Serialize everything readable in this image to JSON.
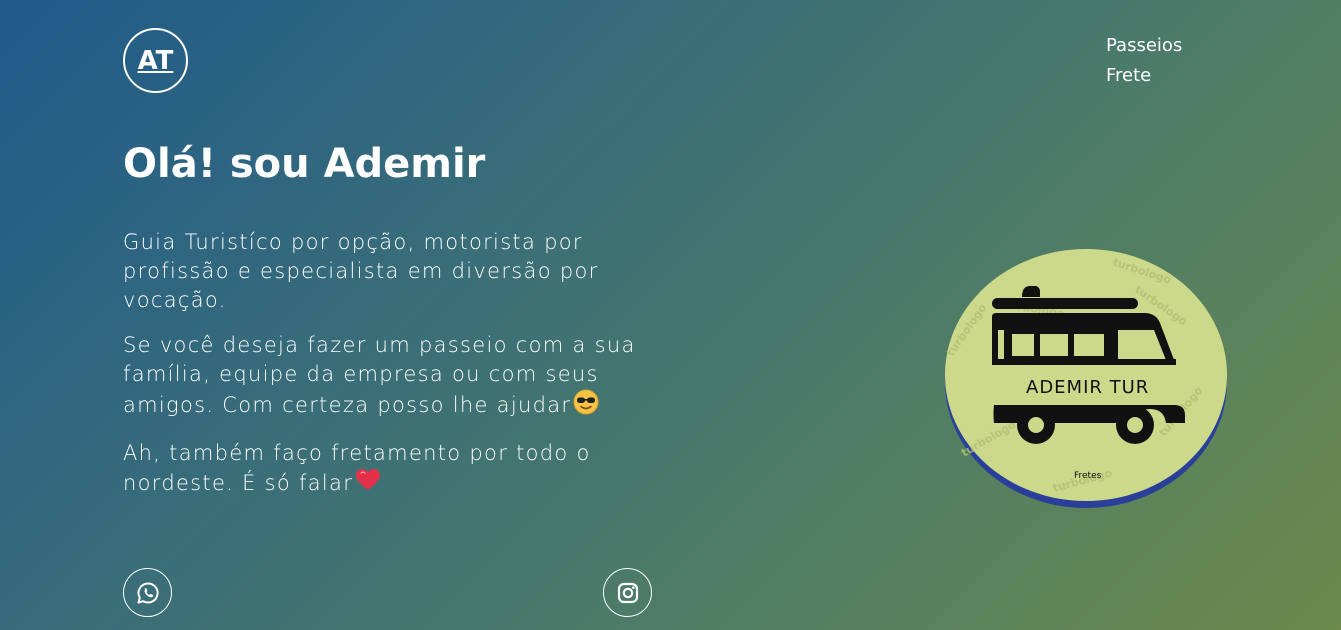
{
  "header": {
    "logo_text": "AT",
    "nav": [
      {
        "label": "Passeios"
      },
      {
        "label": "Frete"
      }
    ]
  },
  "hero": {
    "title": "Olá! sou Ademir",
    "paragraphs": [
      {
        "text": "Guia Turistíco por opção, motorista por profissão e especialista em diversão por vocação."
      },
      {
        "text": "Se você deseja fazer um passeio com a sua família, equipe da empresa ou com seus amigos. Com certeza posso lhe ajudar",
        "emoji": "sunglasses-face-emoji"
      },
      {
        "text": "Ah, também faço fretamento por todo o nordeste. É só falar",
        "emoji": "heart-emoji"
      }
    ]
  },
  "social": {
    "whatsapp_icon": "whatsapp-icon",
    "instagram_icon": "instagram-icon"
  },
  "brand_badge": {
    "name": "ADEMIR TUR",
    "subtitle": "Fretes",
    "watermark": "turbologo",
    "colors": {
      "fill": "#ccd98a",
      "rim": "#2a3f9a",
      "ink": "#111111"
    }
  },
  "colors": {
    "gradient_start": "#1f5a8a",
    "gradient_end": "#6b8a4c",
    "text": "#ffffff"
  }
}
